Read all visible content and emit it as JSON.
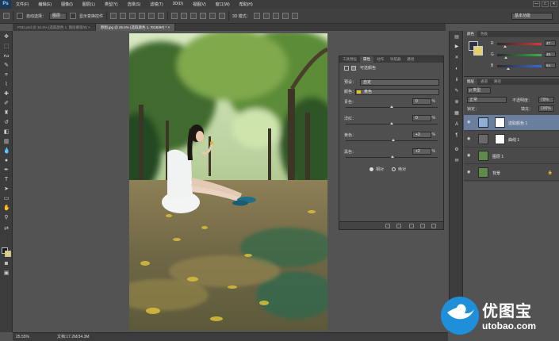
{
  "app": {
    "logo": "Ps",
    "menus": [
      "文件(F)",
      "编辑(E)",
      "图像(I)",
      "图层(L)",
      "类型(Y)",
      "选择(S)",
      "滤镜(T)",
      "3D(D)",
      "视图(V)",
      "窗口(W)",
      "帮助(H)"
    ],
    "window_buttons": [
      "—",
      "□",
      "✕"
    ]
  },
  "options": {
    "auto_select_label": "自动选择：",
    "auto_select_value": "图层",
    "show_transform_label": "显示变换控件",
    "mode_3d_label": "3D 模式：",
    "workspace": "基本功能"
  },
  "doc_tabs": [
    {
      "label": "PSD.psd @ 16.3% (选取颜色 1, 图层蒙版/8) ×",
      "active": false
    },
    {
      "label": "原图.jpg @ 25.5% (选取颜色 1, RGB/8#) * ×",
      "active": true
    }
  ],
  "properties": {
    "tabs": [
      "工具预设",
      "属性",
      "动作",
      "导航器",
      "路径"
    ],
    "active_tab": 1,
    "title": "可选颜色",
    "preset_label": "预设：",
    "preset_value": "自定",
    "colors_label": "颜色：",
    "colors_value": "黄色",
    "swatch": "#e8c21c",
    "sliders": [
      {
        "label": "青色：",
        "value": "0",
        "pos": 0.5
      },
      {
        "label": "洋红：",
        "value": "0",
        "pos": 0.5
      },
      {
        "label": "黄色：",
        "value": "+3",
        "pos": 0.515
      },
      {
        "label": "黑色：",
        "value": "+2",
        "pos": 0.51
      }
    ],
    "percent": "%",
    "mode_relative": "相对",
    "mode_absolute": "绝对"
  },
  "color_panel": {
    "tabs": [
      "颜色",
      "色板"
    ],
    "channels": [
      {
        "name": "R",
        "value": "47",
        "color": "#d83a3a",
        "pos": 0.18
      },
      {
        "name": "G",
        "value": "49",
        "color": "#3ab04a",
        "pos": 0.19
      },
      {
        "name": "B",
        "value": "64",
        "color": "#3a6ad8",
        "pos": 0.25
      }
    ],
    "fg": "#2f3140"
  },
  "layers_panel": {
    "tabs": [
      "图层",
      "通道",
      "路径"
    ],
    "kind_label": "ρ 类型",
    "blend_mode": "正常",
    "opacity_label": "不透明度：",
    "opacity_value": "79%",
    "lock_label": "锁定：",
    "fill_label": "填充：",
    "fill_value": "100%",
    "layers": [
      {
        "name": "选取颜色 1",
        "selected": true
      },
      {
        "name": "曲线 1",
        "selected": false
      },
      {
        "name": "图层 1",
        "selected": false
      },
      {
        "name": "背景",
        "selected": false
      }
    ]
  },
  "status": {
    "zoom": "25.55%",
    "doc": "文档:17.2M/34.3M"
  },
  "watermark": {
    "brand_cn": "优图宝",
    "brand_url": "utobao.com"
  }
}
